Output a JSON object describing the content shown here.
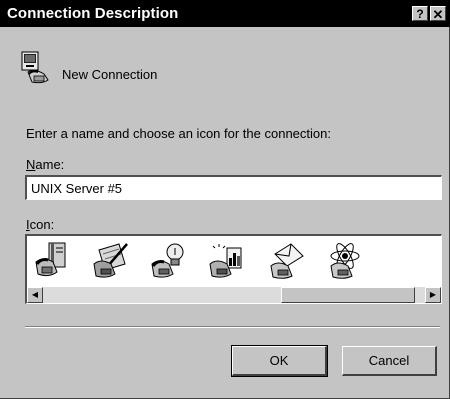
{
  "window": {
    "title": "Connection Description",
    "help_label": "?",
    "close_label": "✕"
  },
  "connection": {
    "name_display": "New Connection"
  },
  "instruction": "Enter a name and choose an icon for the connection:",
  "name_field": {
    "label_access_key": "N",
    "label_rest": "ame:",
    "value": "UNIX Server #5"
  },
  "icon_field": {
    "label_access_key": "I",
    "label_rest": "con:",
    "icons": [
      "phone-book-icon",
      "phone-pen-icon",
      "phone-bulb-icon",
      "phone-chart-icon",
      "phone-envelope-icon",
      "phone-atom-icon"
    ],
    "scroll_left_label": "◀",
    "scroll_right_label": "▶"
  },
  "buttons": {
    "ok_label": "OK",
    "cancel_label": "Cancel"
  }
}
